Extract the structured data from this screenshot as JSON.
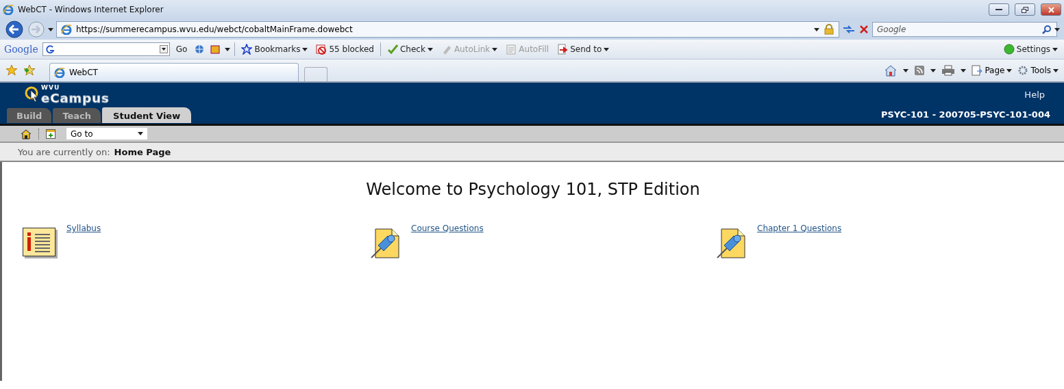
{
  "window": {
    "title": "WebCT - Windows Internet Explorer"
  },
  "address": {
    "url": "https://summerecampus.wvu.edu/webct/cobaltMainFrame.dowebct"
  },
  "search": {
    "placeholder": "Google"
  },
  "google_toolbar": {
    "brand": "Google",
    "items": [
      {
        "label": "Go",
        "disabled": false,
        "kind": "go"
      },
      {
        "label": "Bookmarks",
        "disabled": false,
        "kind": "bookmarks"
      },
      {
        "label": "55 blocked",
        "disabled": false,
        "kind": "blocked"
      },
      {
        "label": "Check",
        "disabled": false,
        "kind": "check"
      },
      {
        "label": "AutoLink",
        "disabled": true,
        "kind": "autolink"
      },
      {
        "label": "AutoFill",
        "disabled": true,
        "kind": "autofill"
      },
      {
        "label": "Send to",
        "disabled": false,
        "kind": "sendto"
      }
    ],
    "settings": "Settings"
  },
  "browser_tabs": [
    {
      "label": "WebCT",
      "selected": true
    }
  ],
  "command_bar": [
    {
      "label": "Page",
      "kind": "page"
    },
    {
      "label": "Tools",
      "kind": "tools"
    }
  ],
  "header": {
    "logo_small": "WVU",
    "logo": "eCampus",
    "help": "Help",
    "course": "PSYC-101 - 200705-PSYC-101-004",
    "tabs": [
      {
        "label": "Build",
        "selected": false
      },
      {
        "label": "Teach",
        "selected": false
      },
      {
        "label": "Student View",
        "selected": true
      }
    ]
  },
  "goto": {
    "value": "Go to"
  },
  "breadcrumb": {
    "label": "You are currently on:",
    "page": "Home Page"
  },
  "heading": "Welcome to Psychology 101, STP Edition",
  "items": [
    {
      "label": "Syllabus",
      "kind": "syllabus"
    },
    {
      "label": "Course Questions",
      "kind": "questions"
    },
    {
      "label": "Chapter 1 Questions",
      "kind": "questions"
    }
  ]
}
